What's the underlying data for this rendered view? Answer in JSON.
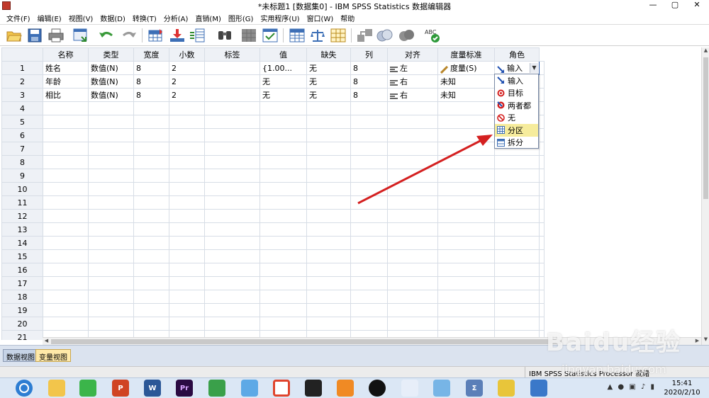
{
  "window": {
    "title": "*未标题1 [数据集0] - IBM SPSS Statistics 数据编辑器",
    "minimize": "—",
    "maximize": "▢",
    "close": "✕"
  },
  "menu": [
    "文件(F)",
    "编辑(E)",
    "视图(V)",
    "数据(D)",
    "转换(T)",
    "分析(A)",
    "直销(M)",
    "图形(G)",
    "实用程序(U)",
    "窗口(W)",
    "帮助"
  ],
  "toolbar_icons": [
    "open-icon",
    "save-icon",
    "print-icon",
    "dialog-recall-icon",
    "undo-icon",
    "redo-icon",
    "goto-case-icon",
    "goto-variable-icon",
    "variables-icon",
    "find-icon",
    "insert-cases-icon",
    "insert-variable-icon",
    "split-file-icon",
    "weight-cases-icon",
    "select-cases-icon",
    "value-labels-icon",
    "use-sets-icon",
    "show-all-icon",
    "spell-check-icon"
  ],
  "grid": {
    "headers": [
      "名称",
      "类型",
      "宽度",
      "小数",
      "标签",
      "值",
      "缺失",
      "列",
      "对齐",
      "度量标准",
      "角色"
    ],
    "rows": [
      {
        "num": "1",
        "cells": [
          "姓名",
          "数值(N)",
          "8",
          "2",
          "",
          "{1.00...",
          "无",
          "8",
          "左",
          "度量(S)",
          "输入"
        ]
      },
      {
        "num": "2",
        "cells": [
          "年龄",
          "数值(N)",
          "8",
          "2",
          "",
          "无",
          "无",
          "8",
          "右",
          "未知",
          ""
        ]
      },
      {
        "num": "3",
        "cells": [
          "相比",
          "数值(N)",
          "8",
          "2",
          "",
          "无",
          "无",
          "8",
          "右",
          "未知",
          ""
        ]
      },
      {
        "num": "4",
        "cells": [
          "",
          "",
          "",
          "",
          "",
          "",
          "",
          "",
          "",
          "",
          ""
        ]
      },
      {
        "num": "5",
        "cells": [
          "",
          "",
          "",
          "",
          "",
          "",
          "",
          "",
          "",
          "",
          ""
        ]
      },
      {
        "num": "6",
        "cells": [
          "",
          "",
          "",
          "",
          "",
          "",
          "",
          "",
          "",
          "",
          ""
        ]
      },
      {
        "num": "7",
        "cells": [
          "",
          "",
          "",
          "",
          "",
          "",
          "",
          "",
          "",
          "",
          ""
        ]
      },
      {
        "num": "8",
        "cells": [
          "",
          "",
          "",
          "",
          "",
          "",
          "",
          "",
          "",
          "",
          ""
        ]
      },
      {
        "num": "9",
        "cells": [
          "",
          "",
          "",
          "",
          "",
          "",
          "",
          "",
          "",
          "",
          ""
        ]
      },
      {
        "num": "10",
        "cells": [
          "",
          "",
          "",
          "",
          "",
          "",
          "",
          "",
          "",
          "",
          ""
        ]
      },
      {
        "num": "11",
        "cells": [
          "",
          "",
          "",
          "",
          "",
          "",
          "",
          "",
          "",
          "",
          ""
        ]
      },
      {
        "num": "12",
        "cells": [
          "",
          "",
          "",
          "",
          "",
          "",
          "",
          "",
          "",
          "",
          ""
        ]
      },
      {
        "num": "13",
        "cells": [
          "",
          "",
          "",
          "",
          "",
          "",
          "",
          "",
          "",
          "",
          ""
        ]
      },
      {
        "num": "14",
        "cells": [
          "",
          "",
          "",
          "",
          "",
          "",
          "",
          "",
          "",
          "",
          ""
        ]
      },
      {
        "num": "15",
        "cells": [
          "",
          "",
          "",
          "",
          "",
          "",
          "",
          "",
          "",
          "",
          ""
        ]
      },
      {
        "num": "16",
        "cells": [
          "",
          "",
          "",
          "",
          "",
          "",
          "",
          "",
          "",
          "",
          ""
        ]
      },
      {
        "num": "17",
        "cells": [
          "",
          "",
          "",
          "",
          "",
          "",
          "",
          "",
          "",
          "",
          ""
        ]
      },
      {
        "num": "18",
        "cells": [
          "",
          "",
          "",
          "",
          "",
          "",
          "",
          "",
          "",
          "",
          ""
        ]
      },
      {
        "num": "19",
        "cells": [
          "",
          "",
          "",
          "",
          "",
          "",
          "",
          "",
          "",
          "",
          ""
        ]
      },
      {
        "num": "20",
        "cells": [
          "",
          "",
          "",
          "",
          "",
          "",
          "",
          "",
          "",
          "",
          ""
        ]
      },
      {
        "num": "21",
        "cells": [
          "",
          "",
          "",
          "",
          "",
          "",
          "",
          "",
          "",
          "",
          ""
        ]
      }
    ]
  },
  "role_dropdown": {
    "options": [
      {
        "label": "输入",
        "icon": "input-arrow-icon"
      },
      {
        "label": "目标",
        "icon": "target-icon"
      },
      {
        "label": "两者都",
        "icon": "both-icon"
      },
      {
        "label": "无",
        "icon": "none-icon"
      },
      {
        "label": "分区",
        "icon": "partition-icon"
      },
      {
        "label": "拆分",
        "icon": "split-icon"
      }
    ],
    "highlighted": "分区"
  },
  "tabs": {
    "data_view": "数据视图",
    "variable_view": "变量视图"
  },
  "status": {
    "processor": "IBM SPSS Statistics Processor 就绪"
  },
  "taskbar": {
    "time": "15:41",
    "date": "2020/2/10"
  },
  "watermark": {
    "main": "Baidu经验",
    "sub": "jingyan.baidu.com"
  },
  "colors": {
    "annotation_arrow": "#d42020",
    "highlight": "#f6ec9c",
    "header_bg": "#eef1f6",
    "active_tab": "#ffe9a8"
  }
}
